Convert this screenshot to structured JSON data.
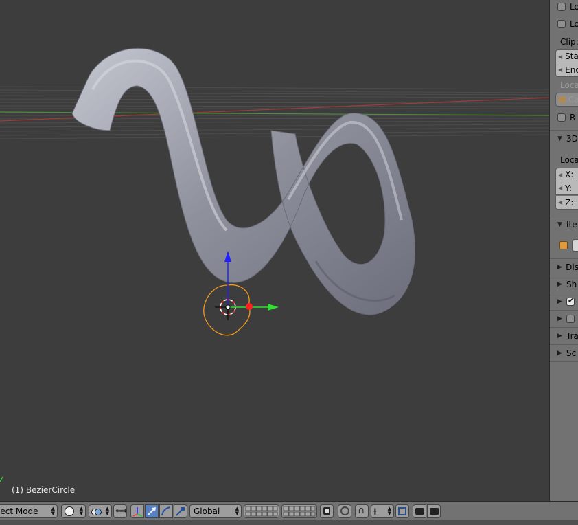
{
  "viewport": {
    "object_label": "(1) BezierCircle"
  },
  "n_panel": {
    "lock_row_1": "Lo",
    "lock_row_2": "Lo",
    "clip_label": "Clip:",
    "clip_start": "Sta",
    "clip_end": "End",
    "local_camera_label": "Loca",
    "camera_field": "Ca",
    "render_border": "R",
    "cursor_panel": "3D",
    "cursor_location": "Loca",
    "cursor_x": "X:",
    "cursor_y": "Y:",
    "cursor_z": "Z:",
    "item_panel": "Ite",
    "display_panel": "Dis",
    "shading_panel": "Sh",
    "transform_panel": "Tra",
    "screen_panel": "Sc"
  },
  "header": {
    "mode": "ject Mode",
    "orientation": "Global"
  },
  "colors": {
    "viewport_bg": "#3d3d3d",
    "panel_bg": "#727272",
    "x_axis": "#ff3030",
    "y_axis": "#30e030",
    "z_axis": "#2020ff",
    "selection": "#f39a1e",
    "active_button": "#5680c2"
  }
}
